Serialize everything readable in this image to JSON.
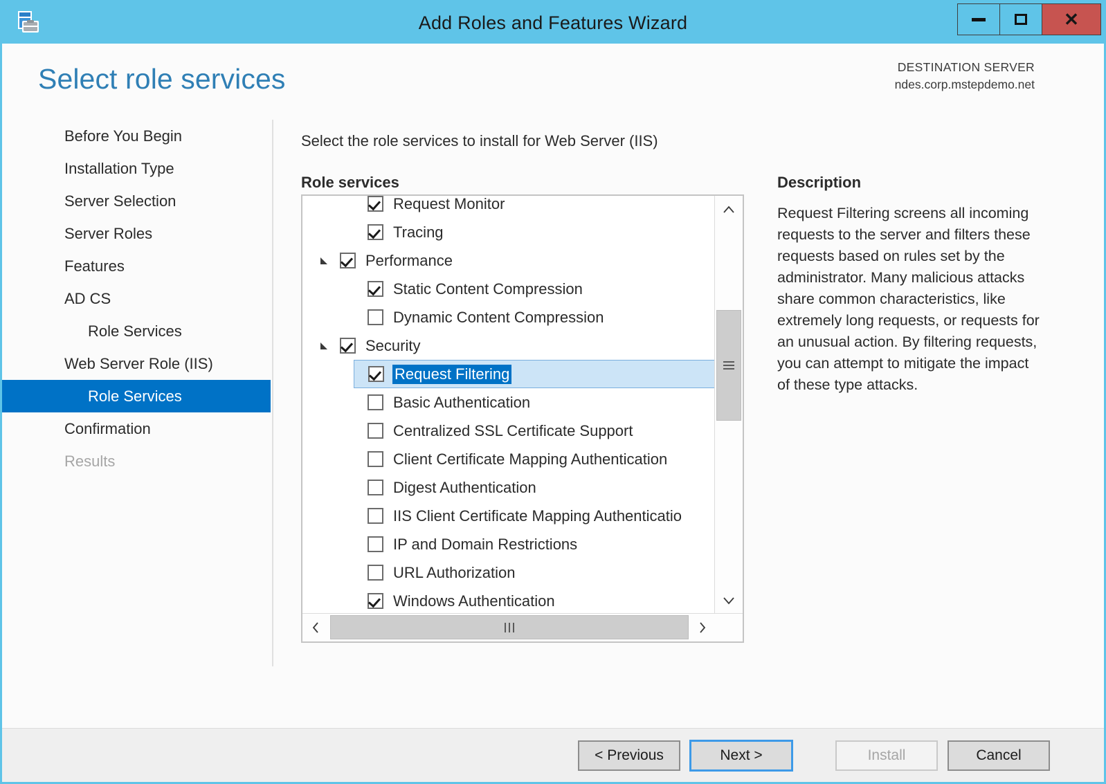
{
  "window": {
    "title": "Add Roles and Features Wizard",
    "icon": "wizard-toolbox-icon",
    "minimize_label": "Minimize",
    "maximize_label": "Maximize",
    "close_label": "Close",
    "titlebar_color": "#5FC4E8",
    "accent_color": "#0072C6"
  },
  "header": {
    "page_title": "Select role services",
    "destination_label": "DESTINATION SERVER",
    "destination_server": "ndes.corp.mstepdemo.net"
  },
  "sidebar": {
    "items": [
      {
        "label": "Before You Begin",
        "level": 0,
        "state": "normal"
      },
      {
        "label": "Installation Type",
        "level": 0,
        "state": "normal"
      },
      {
        "label": "Server Selection",
        "level": 0,
        "state": "normal"
      },
      {
        "label": "Server Roles",
        "level": 0,
        "state": "normal"
      },
      {
        "label": "Features",
        "level": 0,
        "state": "normal"
      },
      {
        "label": "AD CS",
        "level": 0,
        "state": "normal"
      },
      {
        "label": "Role Services",
        "level": 1,
        "state": "normal"
      },
      {
        "label": "Web Server Role (IIS)",
        "level": 0,
        "state": "normal"
      },
      {
        "label": "Role Services",
        "level": 1,
        "state": "selected"
      },
      {
        "label": "Confirmation",
        "level": 0,
        "state": "normal"
      },
      {
        "label": "Results",
        "level": 0,
        "state": "disabled"
      }
    ]
  },
  "main": {
    "instruction": "Select the role services to install for Web Server (IIS)",
    "role_services_heading": "Role services",
    "description_heading": "Description",
    "description_text": "Request Filtering screens all incoming requests to the server and filters these requests based on rules set by the administrator. Many malicious attacks share common characteristics, like extremely long requests, or requests for an unusual action. By filtering requests, you can attempt to mitigate the impact of these type attacks."
  },
  "role_services": {
    "rows": [
      {
        "label": "Request Monitor",
        "indent": 1,
        "checked": true,
        "twisty": "",
        "selected": false,
        "partial_top": true
      },
      {
        "label": "Tracing",
        "indent": 1,
        "checked": true,
        "twisty": "",
        "selected": false
      },
      {
        "label": "Performance",
        "indent": 0,
        "checked": true,
        "twisty": "expanded",
        "selected": false
      },
      {
        "label": "Static Content Compression",
        "indent": 1,
        "checked": true,
        "twisty": "",
        "selected": false
      },
      {
        "label": "Dynamic Content Compression",
        "indent": 1,
        "checked": false,
        "twisty": "",
        "selected": false
      },
      {
        "label": "Security",
        "indent": 0,
        "checked": true,
        "twisty": "expanded",
        "selected": false
      },
      {
        "label": "Request Filtering",
        "indent": 1,
        "checked": true,
        "twisty": "",
        "selected": true
      },
      {
        "label": "Basic Authentication",
        "indent": 1,
        "checked": false,
        "twisty": "",
        "selected": false
      },
      {
        "label": "Centralized SSL Certificate Support",
        "indent": 1,
        "checked": false,
        "twisty": "",
        "selected": false
      },
      {
        "label": "Client Certificate Mapping Authentication",
        "indent": 1,
        "checked": false,
        "twisty": "",
        "selected": false
      },
      {
        "label": "Digest Authentication",
        "indent": 1,
        "checked": false,
        "twisty": "",
        "selected": false
      },
      {
        "label": "IIS Client Certificate Mapping Authenticatio",
        "indent": 1,
        "checked": false,
        "twisty": "",
        "selected": false
      },
      {
        "label": "IP and Domain Restrictions",
        "indent": 1,
        "checked": false,
        "twisty": "",
        "selected": false
      },
      {
        "label": "URL Authorization",
        "indent": 1,
        "checked": false,
        "twisty": "",
        "selected": false
      },
      {
        "label": "Windows Authentication",
        "indent": 1,
        "checked": true,
        "twisty": "",
        "selected": false,
        "partial_bottom": true
      }
    ],
    "scrollbar": {
      "vertical_up": "▲",
      "vertical_down": "▼",
      "horizontal_left": "‹",
      "horizontal_right": "›"
    }
  },
  "footer": {
    "previous_label": "< Previous",
    "next_label": "Next >",
    "install_label": "Install",
    "cancel_label": "Cancel",
    "install_disabled": true,
    "next_focused": true
  }
}
